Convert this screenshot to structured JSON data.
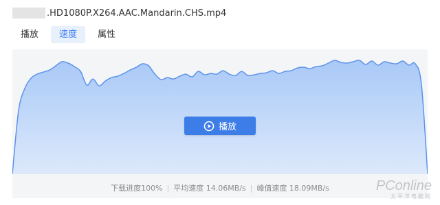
{
  "file": {
    "name": ".HD1080P.X264.AAC.Mandarin.CHS.mp4"
  },
  "tabs": [
    {
      "label": "播放",
      "active": false
    },
    {
      "label": "速度",
      "active": true
    },
    {
      "label": "属性",
      "active": false
    }
  ],
  "player": {
    "play_label": "播放",
    "icon": "play-circle-icon"
  },
  "stats": {
    "progress": "下载进度100%",
    "average": "平均速度 14.06MB/s",
    "peak": "峰值速度 18.09MB/s"
  },
  "watermark": {
    "logo": "PConline",
    "sub": "太平洋电脑网"
  },
  "chart_data": {
    "type": "area",
    "title": "",
    "xlabel": "",
    "ylabel": "",
    "ylim": [
      0,
      18.09
    ],
    "grid": false,
    "legend": "none",
    "colors": {
      "fill_top": "#a9c9f7",
      "fill_bottom": "#dde9fb",
      "stroke": "#5d93ea",
      "background": "#f3f5f7"
    },
    "series": [
      {
        "values": [
          0,
          9.2,
          12.4,
          13.9,
          14.5,
          14.8,
          15.1,
          15.7,
          16.3,
          16.1,
          15.6,
          14.9,
          12.9,
          13.8,
          12.8,
          13.5,
          14.0,
          14.2,
          14.6,
          15.1,
          15.5,
          16.0,
          15.7,
          14.5,
          13.7,
          14.0,
          13.8,
          14.2,
          14.5,
          14.1,
          14.9,
          14.4,
          14.6,
          14.5,
          15.0,
          14.5,
          14.3,
          14.9,
          14.3,
          14.4,
          14.6,
          14.7,
          15.0,
          14.6,
          14.9,
          15.0,
          15.4,
          15.5,
          15.3,
          15.6,
          15.7,
          16.1,
          16.5,
          16.2,
          16.1,
          16.3,
          16.5,
          15.9,
          16.4,
          15.8,
          16.3,
          16.1,
          16.0,
          16.4,
          15.8,
          16.0,
          13.0,
          0
        ]
      }
    ]
  }
}
